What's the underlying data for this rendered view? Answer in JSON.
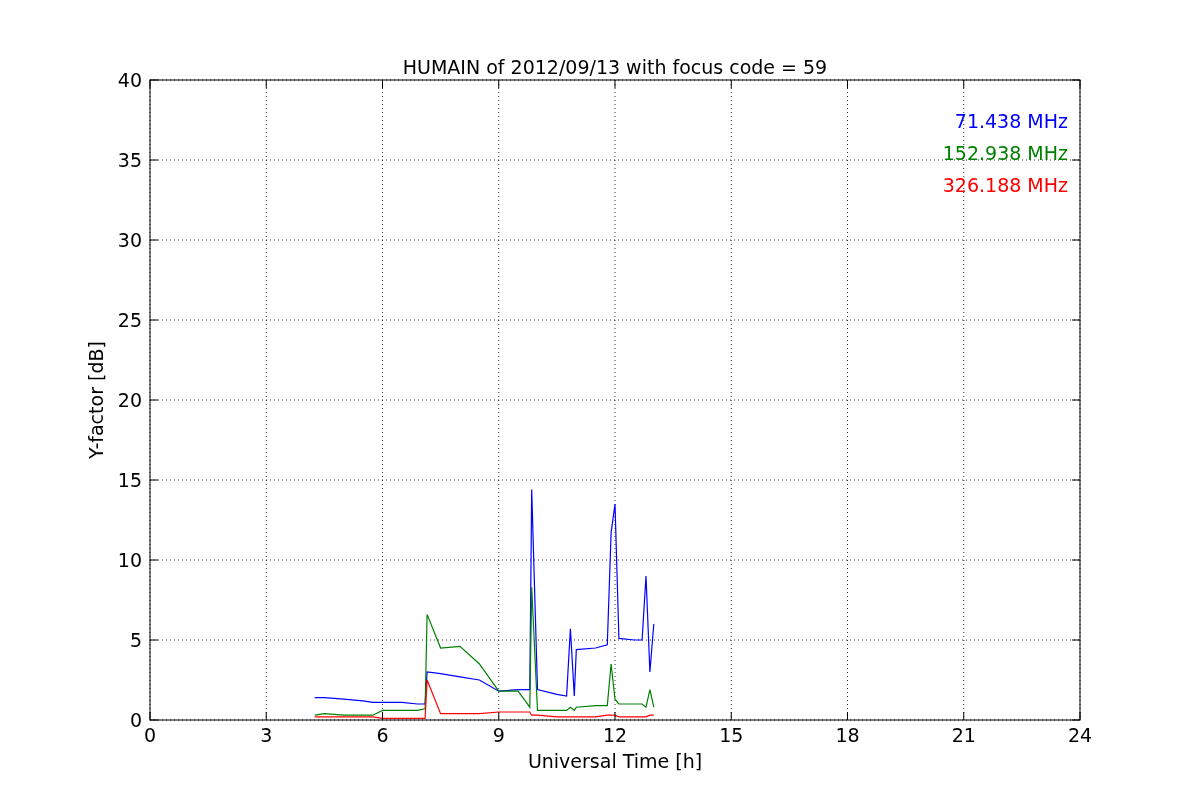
{
  "chart_data": {
    "type": "line",
    "title": "HUMAIN of 2012/09/13 with focus code = 59",
    "xlabel": "Universal Time [h]",
    "ylabel": "Y-factor [dB]",
    "x": [
      4.25,
      4.5,
      5,
      5.5,
      5.75,
      6,
      6.5,
      6.9,
      7.1,
      7.15,
      7.5,
      8,
      8.5,
      9,
      9.5,
      9.8,
      9.85,
      10,
      10.5,
      10.75,
      10.85,
      10.95,
      11,
      11.5,
      11.8,
      11.9,
      12,
      12.1,
      12.5,
      12.7,
      12.8,
      12.9,
      13
    ],
    "series": [
      {
        "name": "71.438 MHz",
        "color": "#0000ff",
        "values": [
          1.4,
          1.4,
          1.3,
          1.2,
          1.1,
          1.1,
          1.1,
          1.0,
          1.0,
          3.0,
          2.9,
          2.7,
          2.5,
          1.8,
          1.9,
          1.9,
          14.4,
          1.9,
          1.6,
          1.5,
          5.7,
          1.5,
          4.4,
          4.5,
          4.7,
          11.7,
          13.5,
          5.1,
          5.0,
          5.0,
          9.0,
          3.0,
          6.0
        ]
      },
      {
        "name": "152.938 MHz",
        "color": "#008000",
        "values": [
          0.3,
          0.4,
          0.3,
          0.3,
          0.3,
          0.6,
          0.6,
          0.6,
          0.7,
          6.6,
          4.5,
          4.6,
          3.5,
          1.8,
          1.8,
          0.8,
          8.3,
          0.6,
          0.6,
          0.6,
          0.8,
          0.6,
          0.8,
          0.9,
          0.9,
          3.5,
          1.3,
          1.0,
          1.0,
          1.0,
          0.8,
          1.9,
          0.8
        ]
      },
      {
        "name": "326.188 MHz",
        "color": "#ff0000",
        "values": [
          0.2,
          0.2,
          0.2,
          0.2,
          0.2,
          0.1,
          0.1,
          0.1,
          0.1,
          2.5,
          0.4,
          0.4,
          0.4,
          0.5,
          0.5,
          0.5,
          0.3,
          0.3,
          0.2,
          0.2,
          0.2,
          0.2,
          0.2,
          0.2,
          0.3,
          0.3,
          0.3,
          0.2,
          0.2,
          0.2,
          0.2,
          0.3,
          0.3
        ]
      }
    ],
    "grid": true,
    "xlim": [
      0,
      24
    ],
    "ylim": [
      0,
      40
    ],
    "xticks": [
      0,
      3,
      6,
      9,
      12,
      15,
      18,
      21,
      24
    ],
    "yticks": [
      0,
      5,
      10,
      15,
      20,
      25,
      30,
      35,
      40
    ]
  }
}
